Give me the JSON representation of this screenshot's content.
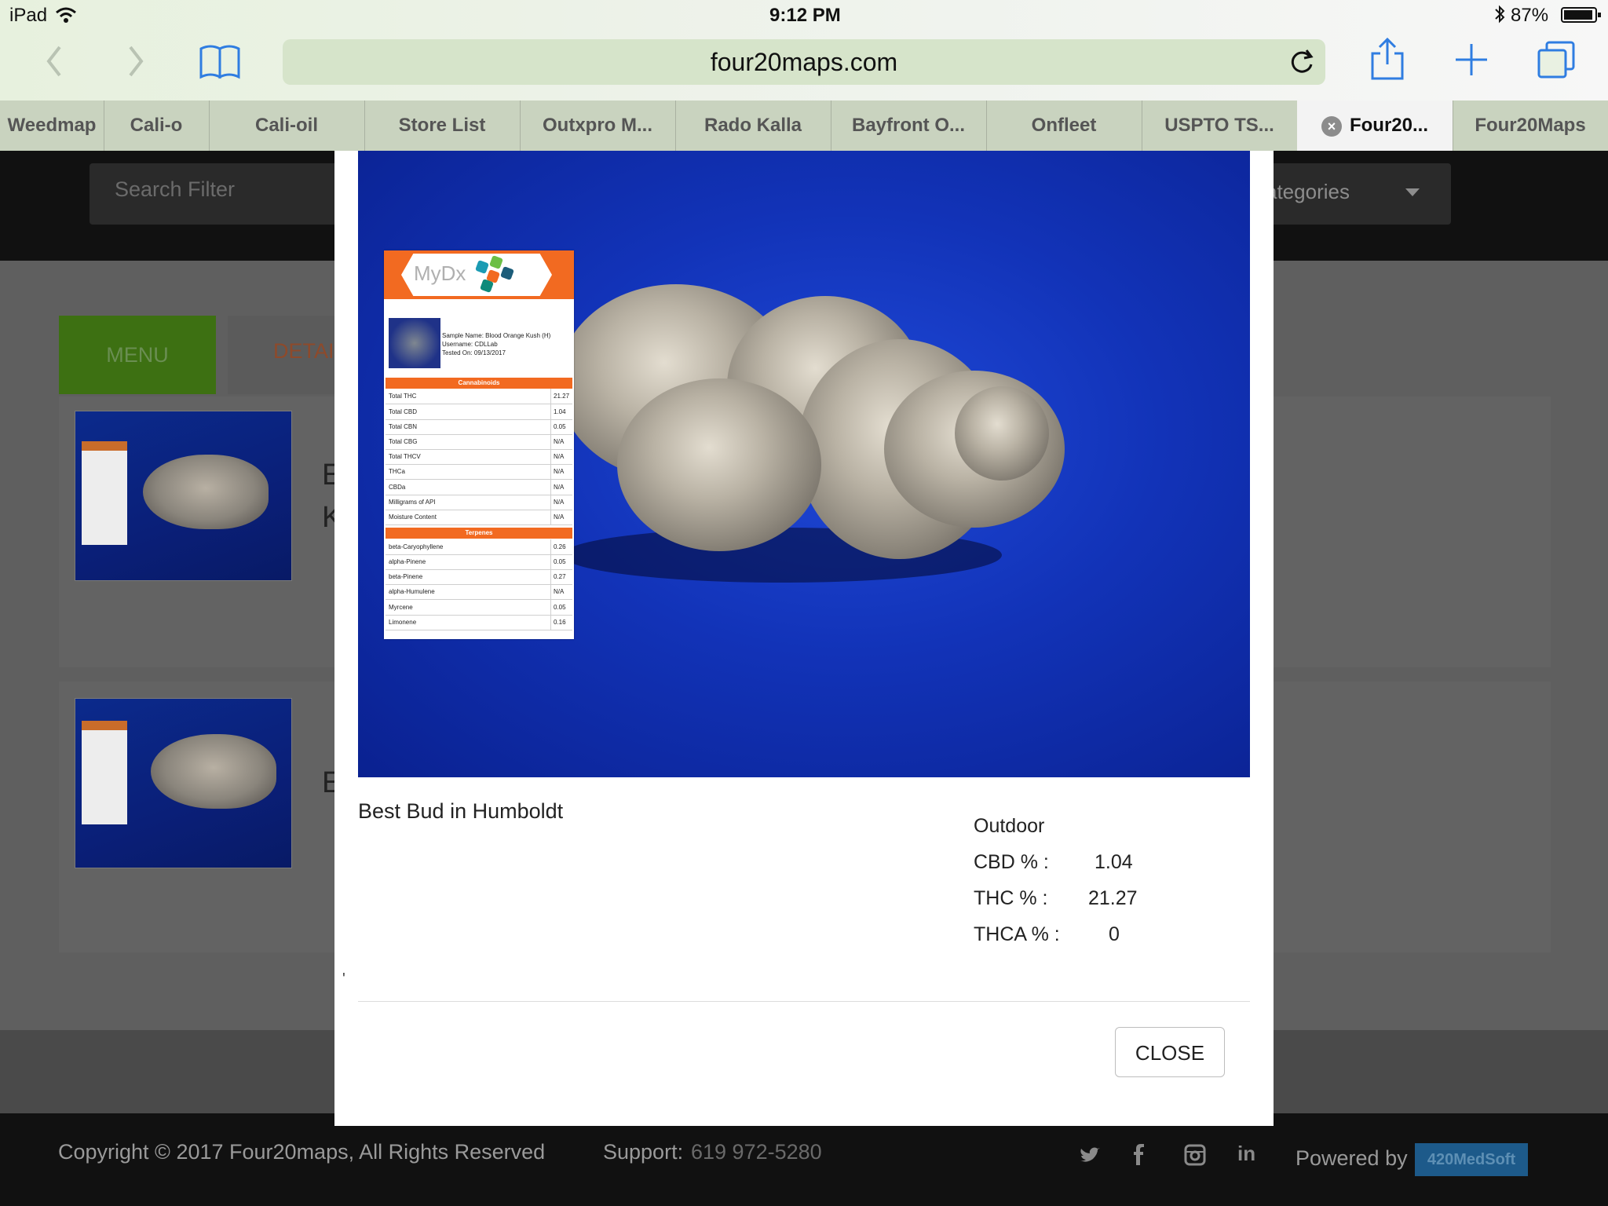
{
  "status_bar": {
    "device": "iPad",
    "time": "9:12 PM",
    "battery": "87%"
  },
  "browser": {
    "url": "four20maps.com",
    "tabs": [
      {
        "label": "Weedmap"
      },
      {
        "label": "Cali-o"
      },
      {
        "label": "Cali-oil"
      },
      {
        "label": "Store List"
      },
      {
        "label": "Outxpro M..."
      },
      {
        "label": "Rado Kalla"
      },
      {
        "label": "Bayfront O..."
      },
      {
        "label": "Onfleet"
      },
      {
        "label": "USPTO TS..."
      },
      {
        "label": "Four20...",
        "active": true
      },
      {
        "label": "Four20Maps"
      }
    ]
  },
  "page": {
    "search_placeholder": "Search Filter",
    "categories_label": "ategories",
    "menu_tab": "MENU",
    "details_tab": "DETAI",
    "card1_chars": [
      "E",
      "K"
    ],
    "card2_chars": [
      "E"
    ],
    "footer": {
      "copyright": "Copyright © 2017 Four20maps, All Rights Reserved",
      "support_label": "Support:",
      "support_phone": "619 972-5280",
      "powered_label": "Powered by",
      "powered_brand": "420MedSoft"
    }
  },
  "modal": {
    "product_name": "Best Bud in Humboldt",
    "growth_type": "Outdoor",
    "stats": [
      {
        "label": "CBD % :",
        "value": "1.04"
      },
      {
        "label": "THC % :",
        "value": "21.27"
      },
      {
        "label": "THCA % :",
        "value": "0"
      }
    ],
    "stray_mark": "'",
    "close_label": "CLOSE",
    "lab_card": {
      "logo": "MyDx",
      "sample_name": "Sample Name: Blood Orange Kush (H)",
      "username": "Username: CDLLab",
      "tested_on": "Tested On: 09/13/2017",
      "cannabinoids_title": "Cannabinoids",
      "cannabinoids": [
        {
          "k": "Total THC",
          "v": "21.27"
        },
        {
          "k": "Total CBD",
          "v": "1.04"
        },
        {
          "k": "Total CBN",
          "v": "0.05"
        },
        {
          "k": "Total CBG",
          "v": "N/A"
        },
        {
          "k": "Total THCV",
          "v": "N/A"
        },
        {
          "k": "THCa",
          "v": "N/A"
        },
        {
          "k": "CBDa",
          "v": "N/A"
        },
        {
          "k": "Milligrams of API",
          "v": "N/A"
        },
        {
          "k": "Moisture Content",
          "v": "N/A"
        }
      ],
      "terpenes_title": "Terpenes",
      "terpenes": [
        {
          "k": "beta-Caryophyllene",
          "v": "0.26"
        },
        {
          "k": "alpha-Pinene",
          "v": "0.05"
        },
        {
          "k": "beta-Pinene",
          "v": "0.27"
        },
        {
          "k": "alpha-Humulene",
          "v": "N/A"
        },
        {
          "k": "Myrcene",
          "v": "0.05"
        },
        {
          "k": "Limonene",
          "v": "0.16"
        }
      ]
    }
  },
  "colors": {
    "accent_green": "#6abf1e",
    "brand_orange": "#f26a21",
    "photo_blue": "#1233b8"
  }
}
